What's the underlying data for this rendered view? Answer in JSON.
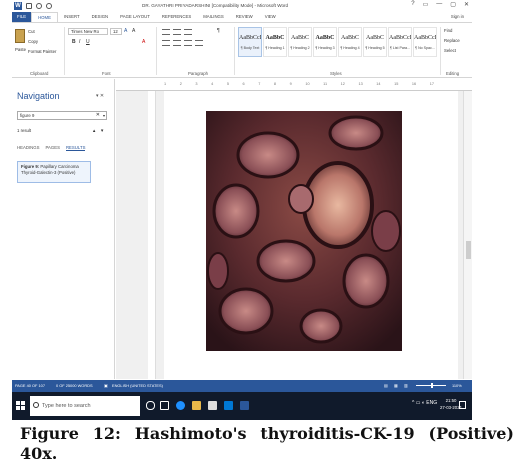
{
  "window": {
    "title": "DR. GAYATHRI PRIYADARSHINI [Compatibility Mode] - Microsoft Word",
    "controls": [
      "?",
      "▭",
      "—",
      "▢",
      "✕"
    ],
    "sign_in": "Sign in"
  },
  "ribbon": {
    "tabs": [
      "FILE",
      "HOME",
      "INSERT",
      "DESIGN",
      "PAGE LAYOUT",
      "REFERENCES",
      "MAILINGS",
      "REVIEW",
      "VIEW"
    ],
    "active_tab": "HOME",
    "clipboard": {
      "paste": "Paste",
      "cut": "Cut",
      "copy": "Copy",
      "format_painter": "Format Painter",
      "label": "Clipboard"
    },
    "font": {
      "name": "Times New Ro",
      "size": "12",
      "label": "Font",
      "bold": "B",
      "italic": "I",
      "underline": "U"
    },
    "paragraph": {
      "label": "Paragraph"
    },
    "styles": {
      "label": "Styles",
      "items": [
        {
          "sample": "AaBbCcL",
          "name": "¶ Body Text"
        },
        {
          "sample": "AaBbC",
          "name": "¶ Heading 1"
        },
        {
          "sample": "AaBbC",
          "name": "¶ Heading 2"
        },
        {
          "sample": "AaBbC",
          "name": "¶ Heading 3"
        },
        {
          "sample": "AaBbC",
          "name": "¶ Heading 4"
        },
        {
          "sample": "AaBbC",
          "name": "¶ Heading 5"
        },
        {
          "sample": "AaBbCcL",
          "name": "¶ List Para..."
        },
        {
          "sample": "AaBbCcL",
          "name": "¶ No Spac..."
        }
      ]
    },
    "editing": {
      "find": "Find",
      "replace": "Replace",
      "select": "Select",
      "label": "Editing"
    }
  },
  "navigation": {
    "title": "Navigation",
    "search_value": "figure 9",
    "result_count": "1 result",
    "tabs": [
      "HEADINGS",
      "PAGES",
      "RESULTS"
    ],
    "active_tab": "RESULTS",
    "result_text_bold": "Figure 9:",
    "result_text": " Papillary Carcinoma Thyroid-Galectin-3 (Positive)"
  },
  "ruler": {
    "ticks": [
      "1",
      "2",
      "3",
      "4",
      "5",
      "6",
      "7",
      "8",
      "9",
      "10",
      "11",
      "12",
      "13",
      "14",
      "15",
      "16",
      "17"
    ]
  },
  "status_bar": {
    "page": "PAGE 40 OF 107",
    "words": "0 OF 25000 WORDS",
    "language": "ENGLISH (UNITED STATES)",
    "zoom": "110%"
  },
  "taskbar": {
    "search_placeholder": "Type here to search",
    "time": "21:50",
    "date": "27-03-2021",
    "language": "ENG"
  },
  "caption": "Figure 12: Hashimoto's thyroiditis-CK-19 (Positive) 40x.",
  "colors": {
    "word_blue": "#2b579a",
    "taskbar": "#101a2b",
    "tissue": "#5a2a2e"
  }
}
